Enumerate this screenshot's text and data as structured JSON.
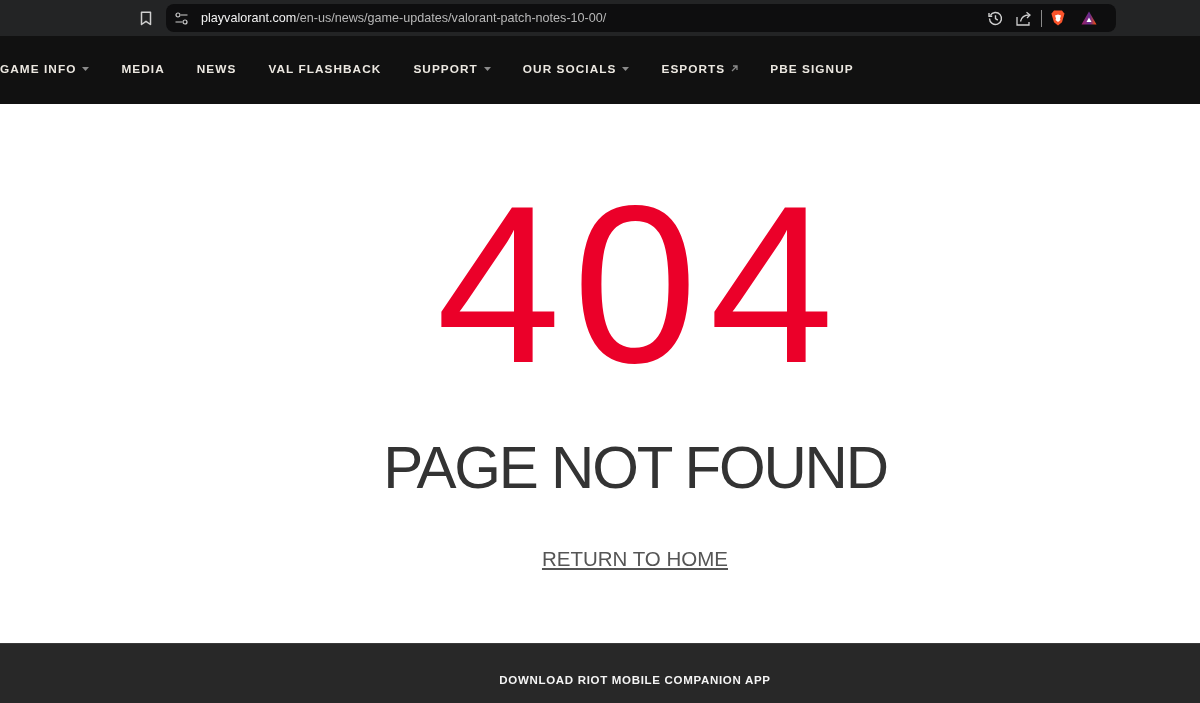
{
  "browser": {
    "url_host": "playvalorant.com",
    "url_path": "/en-us/news/game-updates/valorant-patch-notes-10-00/"
  },
  "nav": {
    "items": [
      {
        "label": "GAME INFO",
        "kind": "dropdown"
      },
      {
        "label": "MEDIA",
        "kind": "link"
      },
      {
        "label": "NEWS",
        "kind": "link"
      },
      {
        "label": "VAL FLASHBACK",
        "kind": "link"
      },
      {
        "label": "SUPPORT",
        "kind": "dropdown"
      },
      {
        "label": "OUR SOCIALS",
        "kind": "dropdown"
      },
      {
        "label": "ESPORTS",
        "kind": "external"
      },
      {
        "label": "PBE SIGNUP",
        "kind": "link"
      }
    ]
  },
  "error": {
    "code": "404",
    "title": "PAGE NOT FOUND",
    "link": "RETURN TO HOME"
  },
  "footer": {
    "text": "DOWNLOAD RIOT MOBILE COMPANION APP"
  }
}
